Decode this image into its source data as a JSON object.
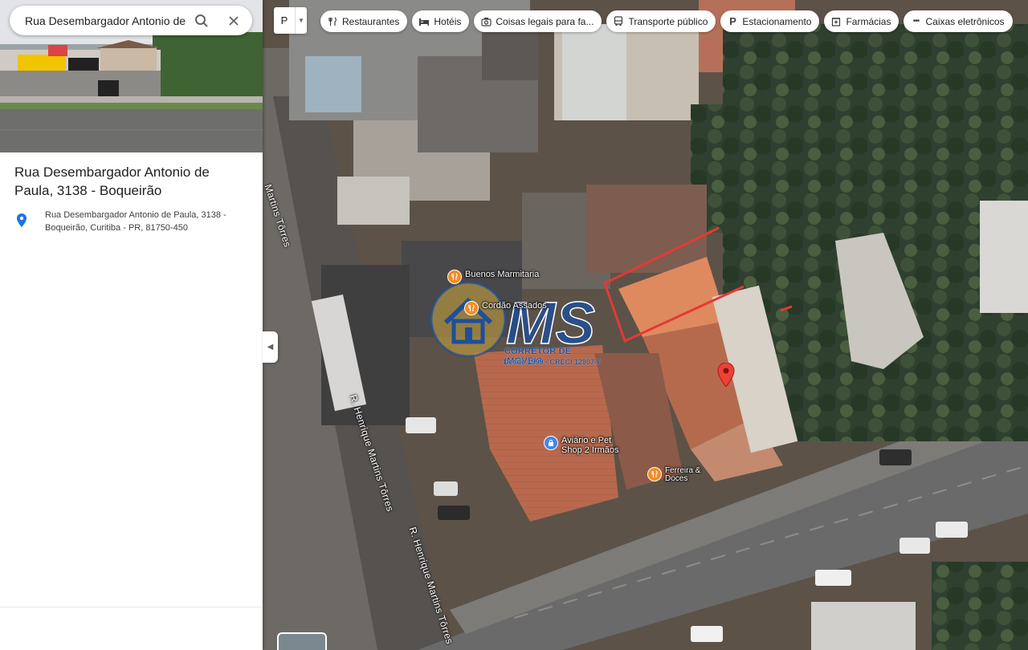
{
  "search": {
    "value": "Rua Desembargador Antonio de Paula",
    "icon": "search-icon",
    "close_icon": "close-icon"
  },
  "place": {
    "title": "Rua Desembargador Antonio de Paula, 3138 - Boqueirão",
    "address": "Rua Desembargador Antonio de Paula, 3138 - Boqueirão, Curitiba - PR, 81750-450",
    "address_icon": "location-pin-icon"
  },
  "layer_toggle": {
    "label": "P"
  },
  "chips": [
    {
      "label": "Restaurantes",
      "icon": "restaurant-icon"
    },
    {
      "label": "Hotéis",
      "icon": "hotel-icon"
    },
    {
      "label": "Coisas legais para fa...",
      "icon": "camera-icon"
    },
    {
      "label": "Transporte público",
      "icon": "bus-icon"
    },
    {
      "label": "Estacionamento",
      "icon": "parking-icon"
    },
    {
      "label": "Farmácias",
      "icon": "pharmacy-icon"
    },
    {
      "label": "Caixas eletrônicos",
      "icon": "atm-icon"
    }
  ],
  "map": {
    "streets": [
      {
        "name": "R. Henrique Martins Tôrres"
      },
      {
        "name": "R. Henrique Martins Tôrres"
      },
      {
        "name": "Martins Tôrres"
      }
    ],
    "pois": [
      {
        "name": "Buenos Marmitaria",
        "icon": "restaurant-icon",
        "color": "#f28c28"
      },
      {
        "name": "Cordão Assados",
        "icon": "restaurant-icon",
        "color": "#f28c28"
      },
      {
        "name": "Aviário e Pet Shop 2 Irmãos",
        "icon": "shopping-bag-icon",
        "color": "#4285f4"
      },
      {
        "name": "Ferreira & Doces",
        "icon": "restaurant-icon",
        "color": "#f28c28"
      }
    ],
    "pin_color": "#ea4335",
    "highlight_color": "#e53935"
  },
  "watermark": {
    "logo": "MS",
    "subtitle": "CORRETOR DE IMÓVEIS",
    "tagline": "Desde 1999 - CRECI 12807-F"
  }
}
